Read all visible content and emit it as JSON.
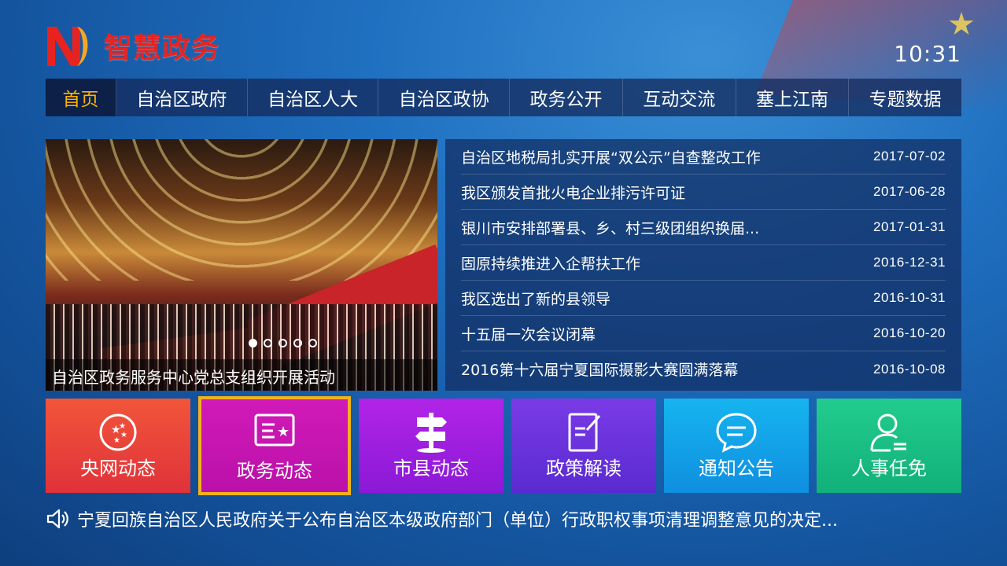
{
  "app": {
    "title": "智慧政务",
    "clock": "10:31",
    "brand_color": "#e8231f"
  },
  "nav": {
    "items": [
      {
        "label": "首页",
        "active": true
      },
      {
        "label": "自治区政府",
        "active": false
      },
      {
        "label": "自治区人大",
        "active": false
      },
      {
        "label": "自治区政协",
        "active": false
      },
      {
        "label": "政务公开",
        "active": false
      },
      {
        "label": "互动交流",
        "active": false
      },
      {
        "label": "塞上江南",
        "active": false
      },
      {
        "label": "专题数据",
        "active": false
      }
    ],
    "active_color": "#ffb400"
  },
  "banner": {
    "caption": "自治区政务服务中心党总支组织开展活动",
    "dots": 5,
    "current_dot": 1
  },
  "news": [
    {
      "title": "自治区地税局扎实开展“双公示”自查整改工作",
      "date": "2017-07-02"
    },
    {
      "title": "我区颁发首批火电企业排污许可证",
      "date": "2017-06-28"
    },
    {
      "title": "银川市安排部署县、乡、村三级团组织换届...",
      "date": "2017-01-31"
    },
    {
      "title": "固原持续推进入企帮扶工作",
      "date": "2016-12-31"
    },
    {
      "title": "我区选出了新的县领导",
      "date": "2016-10-31"
    },
    {
      "title": "十五届一次会议闭幕",
      "date": "2016-10-20"
    },
    {
      "title": "2016第十六届宁夏国际摄影大赛圆满落幕",
      "date": "2016-10-08"
    }
  ],
  "tiles": [
    {
      "label": "央网动态",
      "icon": "star-circle-icon",
      "color": "#e8443a"
    },
    {
      "label": "政务动态",
      "icon": "news-card-icon",
      "color": "#c414b0",
      "focused": true
    },
    {
      "label": "市县动态",
      "icon": "signpost-icon",
      "color": "#9a1fde"
    },
    {
      "label": "政策解读",
      "icon": "edit-document-icon",
      "color": "#6632da"
    },
    {
      "label": "通知公告",
      "icon": "chat-bubble-icon",
      "color": "#14a2e8"
    },
    {
      "label": "人事任免",
      "icon": "user-icon",
      "color": "#1ac084"
    }
  ],
  "focus_color": "#f3b21b",
  "marquee": {
    "icon": "speaker-icon",
    "text": "宁夏回族自治区人民政府关于公布自治区本级政府部门（单位）行政职权事项清理调整意见的决定..."
  }
}
